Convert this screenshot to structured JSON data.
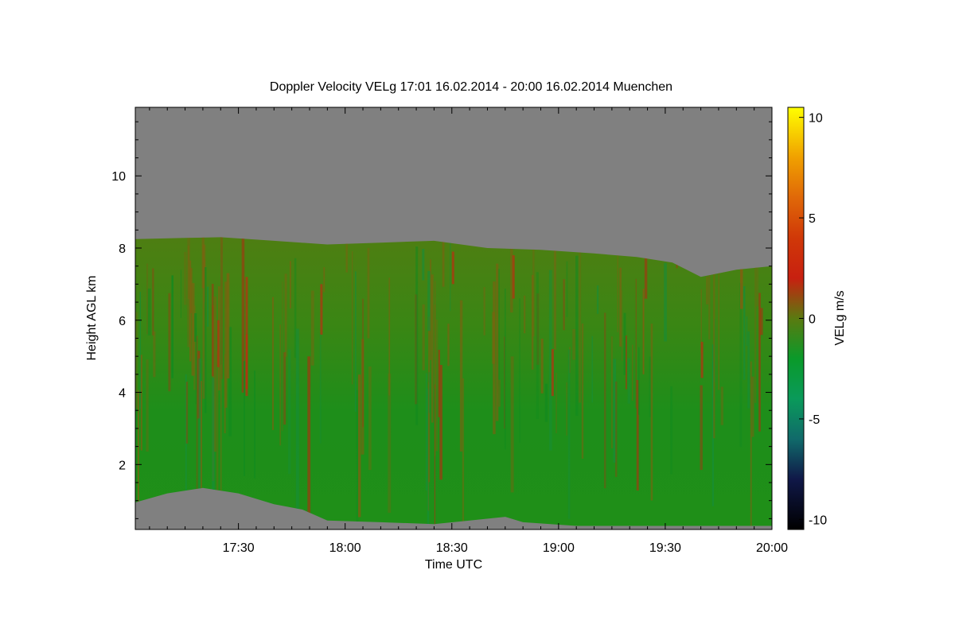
{
  "chart_data": {
    "type": "heatmap",
    "title": "Doppler Velocity VELg   17:01 16.02.2014 - 20:00 16.02.2014 Muenchen",
    "xlabel": "Time UTC",
    "ylabel": "Height AGL km",
    "colorbar_label": "VELg m/s",
    "x_range_minutes_utc": [
      1021,
      1200
    ],
    "ylim": [
      0.2,
      11.9
    ],
    "x_ticks": [
      {
        "label": "17:30",
        "minutes": 1050
      },
      {
        "label": "18:00",
        "minutes": 1080
      },
      {
        "label": "18:30",
        "minutes": 1110
      },
      {
        "label": "19:00",
        "minutes": 1140
      },
      {
        "label": "19:30",
        "minutes": 1170
      },
      {
        "label": "20:00",
        "minutes": 1200
      }
    ],
    "y_ticks": [
      {
        "label": "2",
        "value": 2
      },
      {
        "label": "4",
        "value": 4
      },
      {
        "label": "6",
        "value": 6
      },
      {
        "label": "8",
        "value": 8
      },
      {
        "label": "10",
        "value": 10
      }
    ],
    "colorbar": {
      "range": [
        -10.5,
        10.5
      ],
      "ticks": [
        {
          "label": "10",
          "value": 10
        },
        {
          "label": "5",
          "value": 5
        },
        {
          "label": "0",
          "value": 0
        },
        {
          "label": "-5",
          "value": -5
        },
        {
          "label": "-10",
          "value": -10
        }
      ],
      "stops": [
        {
          "v": -10.5,
          "color": "#000000"
        },
        {
          "v": -8,
          "color": "#101848"
        },
        {
          "v": -6,
          "color": "#106a6a"
        },
        {
          "v": -4,
          "color": "#0a9a5a"
        },
        {
          "v": -2,
          "color": "#0a9a2a"
        },
        {
          "v": 0,
          "color": "#5a7a10"
        },
        {
          "v": 2,
          "color": "#c82010"
        },
        {
          "v": 4,
          "color": "#d03808"
        },
        {
          "v": 6,
          "color": "#e06808"
        },
        {
          "v": 8,
          "color": "#f0a000"
        },
        {
          "v": 10.5,
          "color": "#ffff00"
        }
      ]
    },
    "no_data_color": "#808080",
    "cloud_top_km": [
      {
        "minutes": 1021,
        "height": 8.25
      },
      {
        "minutes": 1035,
        "height": 8.28
      },
      {
        "minutes": 1045,
        "height": 8.3
      },
      {
        "minutes": 1060,
        "height": 8.2
      },
      {
        "minutes": 1075,
        "height": 8.1
      },
      {
        "minutes": 1090,
        "height": 8.15
      },
      {
        "minutes": 1105,
        "height": 8.2
      },
      {
        "minutes": 1120,
        "height": 8.0
      },
      {
        "minutes": 1135,
        "height": 7.95
      },
      {
        "minutes": 1150,
        "height": 7.85
      },
      {
        "minutes": 1162,
        "height": 7.75
      },
      {
        "minutes": 1172,
        "height": 7.6
      },
      {
        "minutes": 1180,
        "height": 7.2
      },
      {
        "minutes": 1190,
        "height": 7.4
      },
      {
        "minutes": 1200,
        "height": 7.5
      }
    ],
    "cloud_base_km": [
      {
        "minutes": 1021,
        "height": 0.95
      },
      {
        "minutes": 1030,
        "height": 1.2
      },
      {
        "minutes": 1040,
        "height": 1.35
      },
      {
        "minutes": 1050,
        "height": 1.2
      },
      {
        "minutes": 1060,
        "height": 0.9
      },
      {
        "minutes": 1068,
        "height": 0.75
      },
      {
        "minutes": 1075,
        "height": 0.45
      },
      {
        "minutes": 1090,
        "height": 0.4
      },
      {
        "minutes": 1105,
        "height": 0.35
      },
      {
        "minutes": 1115,
        "height": 0.45
      },
      {
        "minutes": 1125,
        "height": 0.55
      },
      {
        "minutes": 1130,
        "height": 0.4
      },
      {
        "minutes": 1145,
        "height": 0.3
      },
      {
        "minutes": 1200,
        "height": 0.3
      }
    ]
  }
}
